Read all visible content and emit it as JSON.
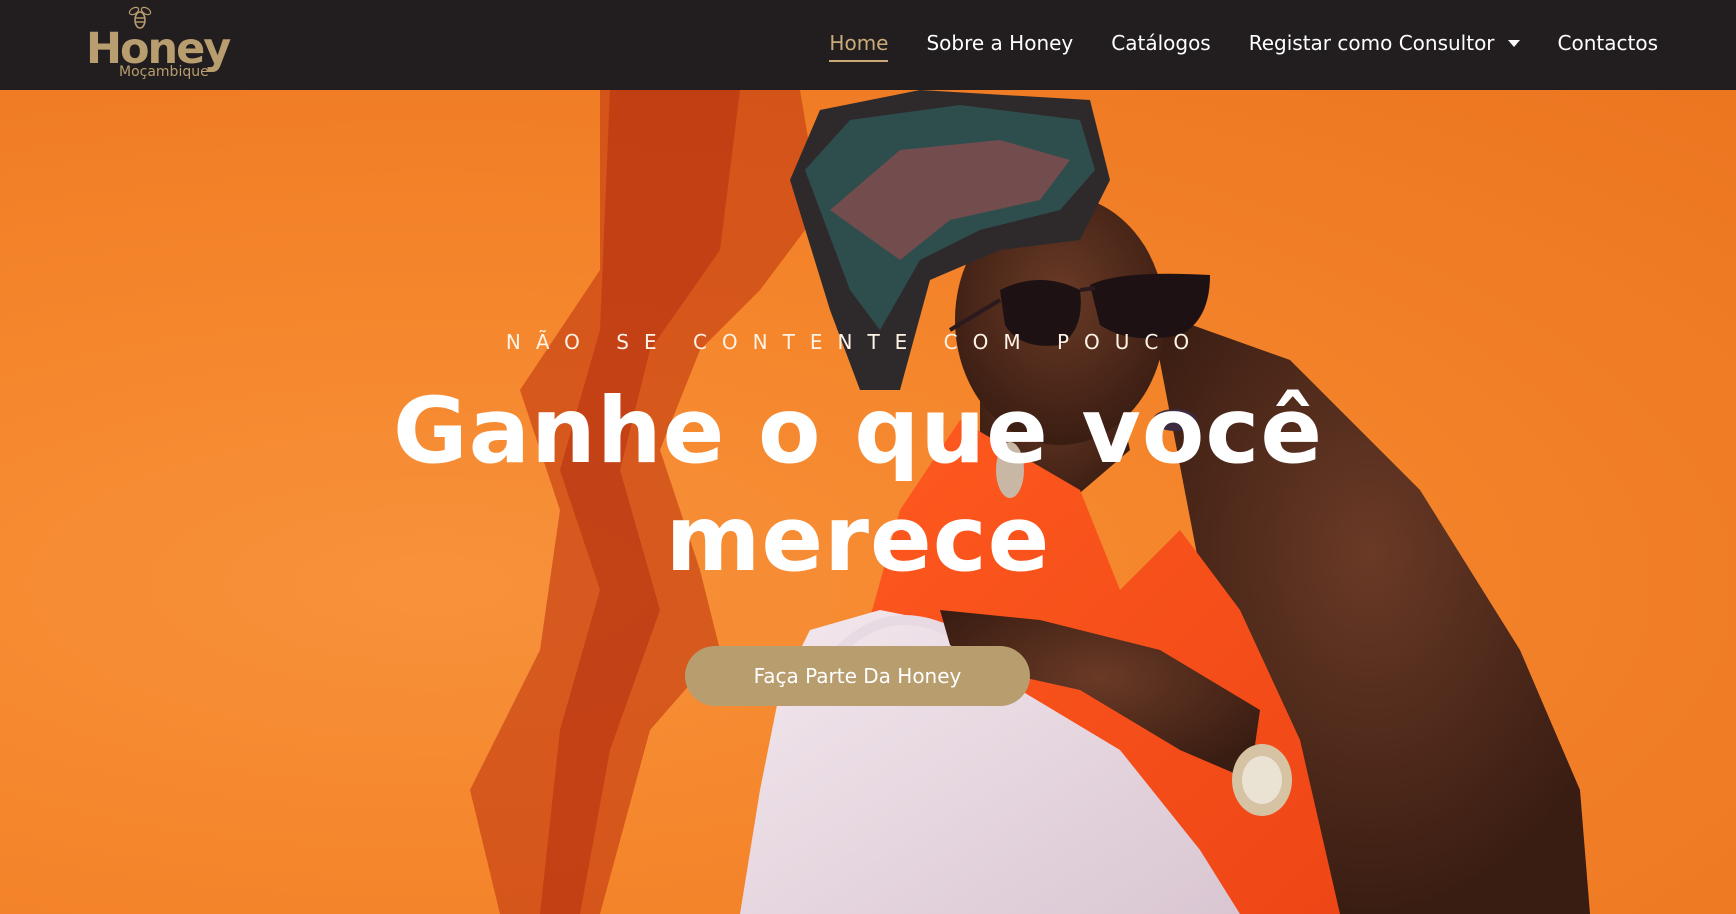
{
  "brand": {
    "logo_word": "Honey",
    "logo_sub": "Moçambique",
    "gold": "#b89d6e",
    "header_bg": "#221e1f"
  },
  "nav": {
    "items": [
      {
        "label": "Home",
        "active": true
      },
      {
        "label": "Sobre a Honey"
      },
      {
        "label": "Catálogos"
      },
      {
        "label": "Registar como Consultor",
        "has_dropdown": true,
        "icon": "caret-down-icon"
      },
      {
        "label": "Contactos"
      }
    ]
  },
  "hero": {
    "eyebrow": "NÃO SE CONTENTE COM POUCO",
    "headline_line1": "Ganhe o que você",
    "headline_line2": "merece",
    "cta_label": "Faça Parte Da Honey",
    "background_color": "#f5862c"
  }
}
